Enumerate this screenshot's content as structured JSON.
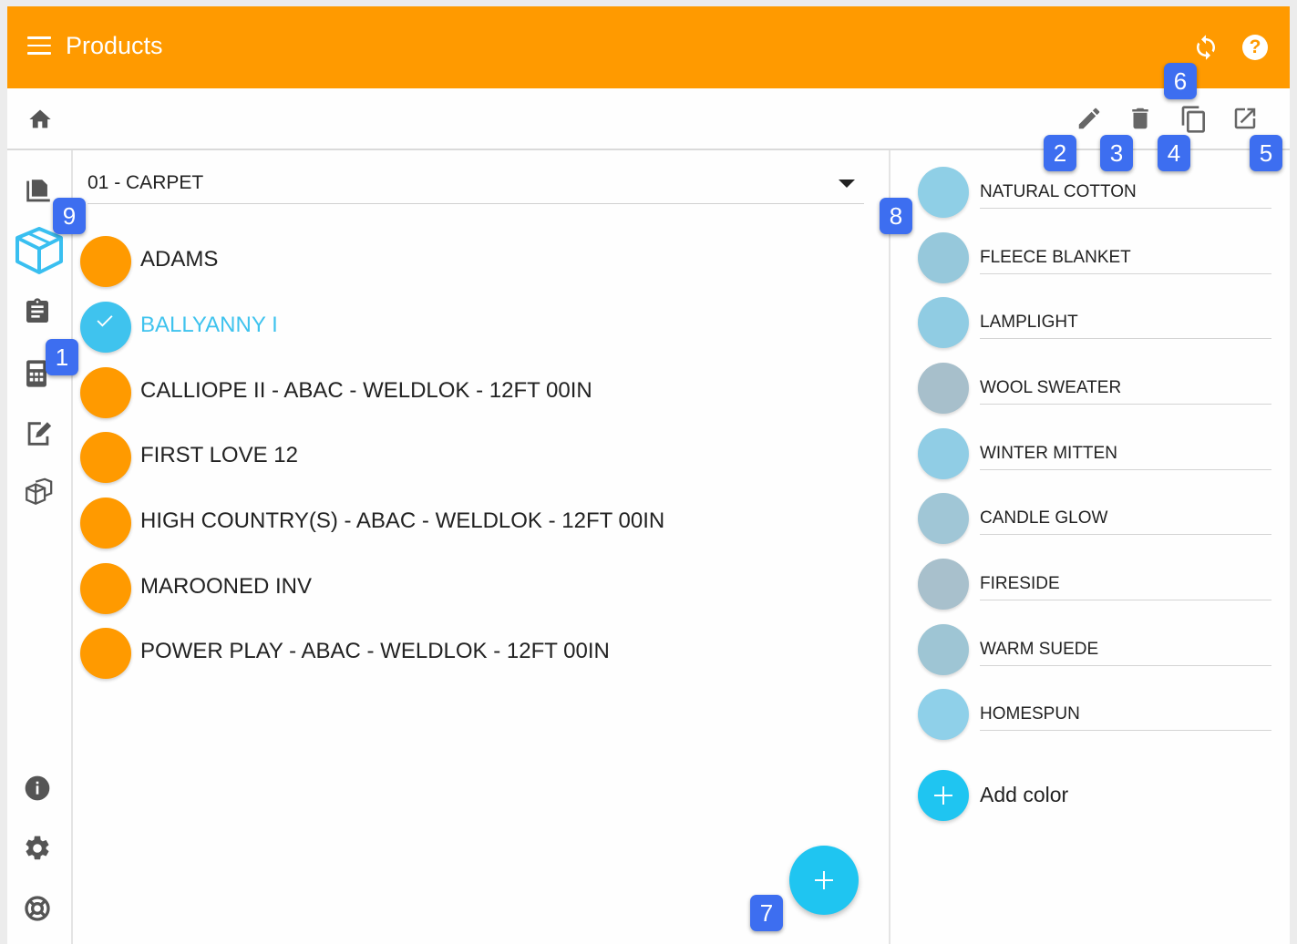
{
  "appbar": {
    "title": "Products",
    "icons": [
      "menu-icon",
      "sync-icon",
      "help-icon"
    ],
    "help_glyph": "?"
  },
  "toolbar": {
    "icons": [
      "home-icon",
      "edit-icon",
      "delete-icon",
      "copy-icon",
      "open-external-icon"
    ]
  },
  "rail": {
    "items": [
      "catalog-icon",
      "products-box-icon",
      "clipboard-icon",
      "calculator-icon",
      "signature-icon",
      "boxes-icon",
      "info-icon",
      "settings-icon",
      "support-icon"
    ]
  },
  "category_select": {
    "value": "01 - CARPET"
  },
  "products": [
    {
      "label": "ADAMS",
      "selected": false
    },
    {
      "label": "BALLYANNY I",
      "selected": true
    },
    {
      "label": "CALLIOPE II - ABAC - WELDLOK - 12FT 00IN",
      "selected": false
    },
    {
      "label": "FIRST LOVE 12",
      "selected": false
    },
    {
      "label": "HIGH COUNTRY(S) - ABAC - WELDLOK - 12FT 00IN",
      "selected": false
    },
    {
      "label": "MAROONED INV",
      "selected": false
    },
    {
      "label": "POWER PLAY - ABAC - WELDLOK - 12FT 00IN",
      "selected": false
    }
  ],
  "colors": [
    {
      "label": "NATURAL COTTON",
      "swatch": "#8fcfe6"
    },
    {
      "label": "FLEECE BLANKET",
      "swatch": "#96c8db"
    },
    {
      "label": "LAMPLIGHT",
      "swatch": "#90cce3"
    },
    {
      "label": "WOOL SWEATER",
      "swatch": "#a7bfcb"
    },
    {
      "label": "WINTER MITTEN",
      "swatch": "#90cde5"
    },
    {
      "label": "CANDLE GLOW",
      "swatch": "#a0c6d6"
    },
    {
      "label": "FIRESIDE",
      "swatch": "#a8c0cc"
    },
    {
      "label": "WARM SUEDE",
      "swatch": "#9ec5d4"
    },
    {
      "label": "HOMESPUN",
      "swatch": "#8fd0e9"
    }
  ],
  "add_color": {
    "label": "Add color"
  },
  "theme": {
    "primary": "#ff9a00",
    "accent": "#1fc5f1",
    "selected_text": "#3fc3ee",
    "badge": "#3d6ef0"
  },
  "badges": [
    "1",
    "2",
    "3",
    "4",
    "5",
    "6",
    "7",
    "8",
    "9"
  ]
}
